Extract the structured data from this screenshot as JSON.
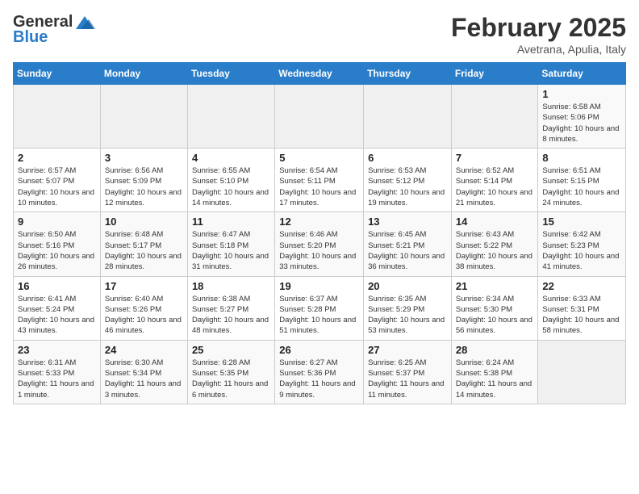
{
  "header": {
    "logo_general": "General",
    "logo_blue": "Blue",
    "month": "February 2025",
    "location": "Avetrana, Apulia, Italy"
  },
  "weekdays": [
    "Sunday",
    "Monday",
    "Tuesday",
    "Wednesday",
    "Thursday",
    "Friday",
    "Saturday"
  ],
  "weeks": [
    [
      {
        "day": "",
        "sunrise": "",
        "sunset": "",
        "daylight": "",
        "empty": true
      },
      {
        "day": "",
        "sunrise": "",
        "sunset": "",
        "daylight": "",
        "empty": true
      },
      {
        "day": "",
        "sunrise": "",
        "sunset": "",
        "daylight": "",
        "empty": true
      },
      {
        "day": "",
        "sunrise": "",
        "sunset": "",
        "daylight": "",
        "empty": true
      },
      {
        "day": "",
        "sunrise": "",
        "sunset": "",
        "daylight": "",
        "empty": true
      },
      {
        "day": "",
        "sunrise": "",
        "sunset": "",
        "daylight": "",
        "empty": true
      },
      {
        "day": "1",
        "sunrise": "6:58 AM",
        "sunset": "5:06 PM",
        "daylight": "10 hours and 8 minutes.",
        "empty": false
      }
    ],
    [
      {
        "day": "2",
        "sunrise": "6:57 AM",
        "sunset": "5:07 PM",
        "daylight": "10 hours and 10 minutes.",
        "empty": false
      },
      {
        "day": "3",
        "sunrise": "6:56 AM",
        "sunset": "5:09 PM",
        "daylight": "10 hours and 12 minutes.",
        "empty": false
      },
      {
        "day": "4",
        "sunrise": "6:55 AM",
        "sunset": "5:10 PM",
        "daylight": "10 hours and 14 minutes.",
        "empty": false
      },
      {
        "day": "5",
        "sunrise": "6:54 AM",
        "sunset": "5:11 PM",
        "daylight": "10 hours and 17 minutes.",
        "empty": false
      },
      {
        "day": "6",
        "sunrise": "6:53 AM",
        "sunset": "5:12 PM",
        "daylight": "10 hours and 19 minutes.",
        "empty": false
      },
      {
        "day": "7",
        "sunrise": "6:52 AM",
        "sunset": "5:14 PM",
        "daylight": "10 hours and 21 minutes.",
        "empty": false
      },
      {
        "day": "8",
        "sunrise": "6:51 AM",
        "sunset": "5:15 PM",
        "daylight": "10 hours and 24 minutes.",
        "empty": false
      }
    ],
    [
      {
        "day": "9",
        "sunrise": "6:50 AM",
        "sunset": "5:16 PM",
        "daylight": "10 hours and 26 minutes.",
        "empty": false
      },
      {
        "day": "10",
        "sunrise": "6:48 AM",
        "sunset": "5:17 PM",
        "daylight": "10 hours and 28 minutes.",
        "empty": false
      },
      {
        "day": "11",
        "sunrise": "6:47 AM",
        "sunset": "5:18 PM",
        "daylight": "10 hours and 31 minutes.",
        "empty": false
      },
      {
        "day": "12",
        "sunrise": "6:46 AM",
        "sunset": "5:20 PM",
        "daylight": "10 hours and 33 minutes.",
        "empty": false
      },
      {
        "day": "13",
        "sunrise": "6:45 AM",
        "sunset": "5:21 PM",
        "daylight": "10 hours and 36 minutes.",
        "empty": false
      },
      {
        "day": "14",
        "sunrise": "6:43 AM",
        "sunset": "5:22 PM",
        "daylight": "10 hours and 38 minutes.",
        "empty": false
      },
      {
        "day": "15",
        "sunrise": "6:42 AM",
        "sunset": "5:23 PM",
        "daylight": "10 hours and 41 minutes.",
        "empty": false
      }
    ],
    [
      {
        "day": "16",
        "sunrise": "6:41 AM",
        "sunset": "5:24 PM",
        "daylight": "10 hours and 43 minutes.",
        "empty": false
      },
      {
        "day": "17",
        "sunrise": "6:40 AM",
        "sunset": "5:26 PM",
        "daylight": "10 hours and 46 minutes.",
        "empty": false
      },
      {
        "day": "18",
        "sunrise": "6:38 AM",
        "sunset": "5:27 PM",
        "daylight": "10 hours and 48 minutes.",
        "empty": false
      },
      {
        "day": "19",
        "sunrise": "6:37 AM",
        "sunset": "5:28 PM",
        "daylight": "10 hours and 51 minutes.",
        "empty": false
      },
      {
        "day": "20",
        "sunrise": "6:35 AM",
        "sunset": "5:29 PM",
        "daylight": "10 hours and 53 minutes.",
        "empty": false
      },
      {
        "day": "21",
        "sunrise": "6:34 AM",
        "sunset": "5:30 PM",
        "daylight": "10 hours and 56 minutes.",
        "empty": false
      },
      {
        "day": "22",
        "sunrise": "6:33 AM",
        "sunset": "5:31 PM",
        "daylight": "10 hours and 58 minutes.",
        "empty": false
      }
    ],
    [
      {
        "day": "23",
        "sunrise": "6:31 AM",
        "sunset": "5:33 PM",
        "daylight": "11 hours and 1 minute.",
        "empty": false
      },
      {
        "day": "24",
        "sunrise": "6:30 AM",
        "sunset": "5:34 PM",
        "daylight": "11 hours and 3 minutes.",
        "empty": false
      },
      {
        "day": "25",
        "sunrise": "6:28 AM",
        "sunset": "5:35 PM",
        "daylight": "11 hours and 6 minutes.",
        "empty": false
      },
      {
        "day": "26",
        "sunrise": "6:27 AM",
        "sunset": "5:36 PM",
        "daylight": "11 hours and 9 minutes.",
        "empty": false
      },
      {
        "day": "27",
        "sunrise": "6:25 AM",
        "sunset": "5:37 PM",
        "daylight": "11 hours and 11 minutes.",
        "empty": false
      },
      {
        "day": "28",
        "sunrise": "6:24 AM",
        "sunset": "5:38 PM",
        "daylight": "11 hours and 14 minutes.",
        "empty": false
      },
      {
        "day": "",
        "sunrise": "",
        "sunset": "",
        "daylight": "",
        "empty": true
      }
    ]
  ]
}
